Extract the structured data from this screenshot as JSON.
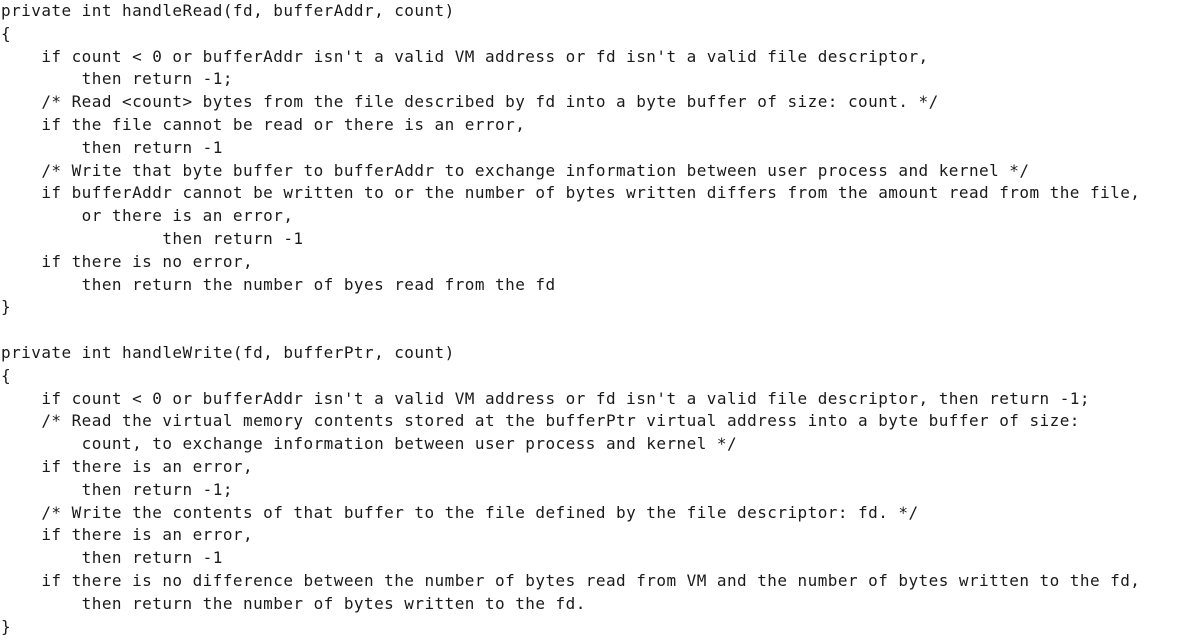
{
  "code_lines": [
    "private int handleRead(fd, bufferAddr, count)",
    "{",
    "    if count < 0 or bufferAddr isn't a valid VM address or fd isn't a valid file descriptor,",
    "        then return -1;",
    "    /* Read <count> bytes from the file described by fd into a byte buffer of size: count. */",
    "    if the file cannot be read or there is an error,",
    "        then return -1",
    "    /* Write that byte buffer to bufferAddr to exchange information between user process and kernel */",
    "    if bufferAddr cannot be written to or the number of bytes written differs from the amount read from the file,",
    "        or there is an error,",
    "                then return -1",
    "    if there is no error,",
    "        then return the number of byes read from the fd",
    "}",
    "",
    "private int handleWrite(fd, bufferPtr, count)",
    "{",
    "    if count < 0 or bufferAddr isn't a valid VM address or fd isn't a valid file descriptor, then return -1;",
    "    /* Read the virtual memory contents stored at the bufferPtr virtual address into a byte buffer of size:",
    "        count, to exchange information between user process and kernel */",
    "    if there is an error,",
    "        then return -1;",
    "    /* Write the contents of that buffer to the file defined by the file descriptor: fd. */",
    "    if there is an error,",
    "        then return -1",
    "    if there is no difference between the number of bytes read from VM and the number of bytes written to the fd,",
    "        then return the number of bytes written to the fd.",
    "}"
  ]
}
